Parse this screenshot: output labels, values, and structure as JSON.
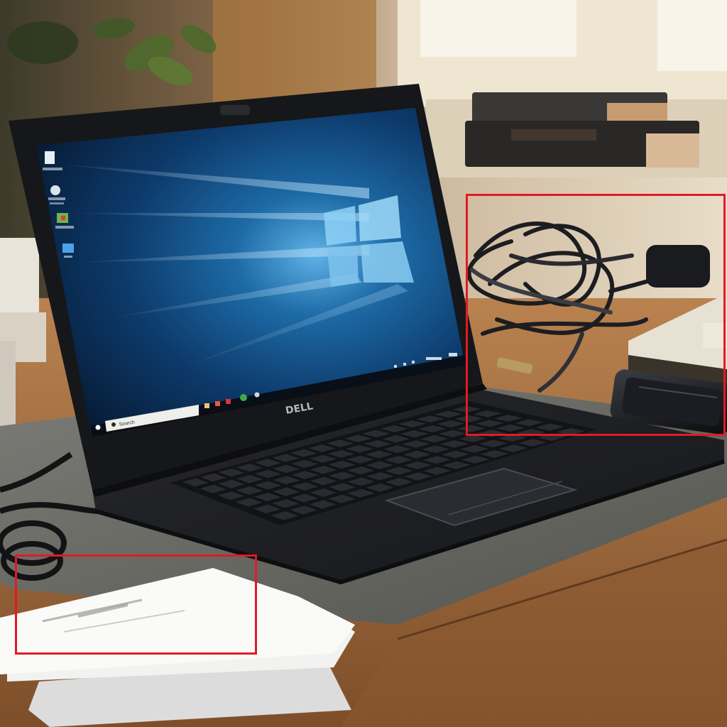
{
  "laptop": {
    "brand_logo": "DELL",
    "screen": {
      "os_logo_icon": "windows-logo-icon",
      "desktop_icons": [
        {
          "icon": "file-icon"
        },
        {
          "icon": "app-icon"
        },
        {
          "icon": "shortcut-icon"
        },
        {
          "icon": "folder-icon"
        }
      ],
      "taskbar": {
        "start_icon": "start-icon",
        "search_text": "Search",
        "pinned_icons": [
          "explorer-icon",
          "browser-icon",
          "app-icon",
          "chrome-icon",
          "people-icon"
        ]
      }
    }
  },
  "highlights": {
    "colors": {
      "box": "#e01b24"
    },
    "items": [
      {
        "label": "cables-and-phone-region"
      },
      {
        "label": "papers-region"
      }
    ]
  },
  "colors": {
    "wall": "#cbb59a",
    "window": "#f1ead8",
    "desk": "#a36f43",
    "felt_mat": "#6a6a66",
    "laptop_body": "#1e1f23",
    "screen_blue": "#0f3f73"
  }
}
